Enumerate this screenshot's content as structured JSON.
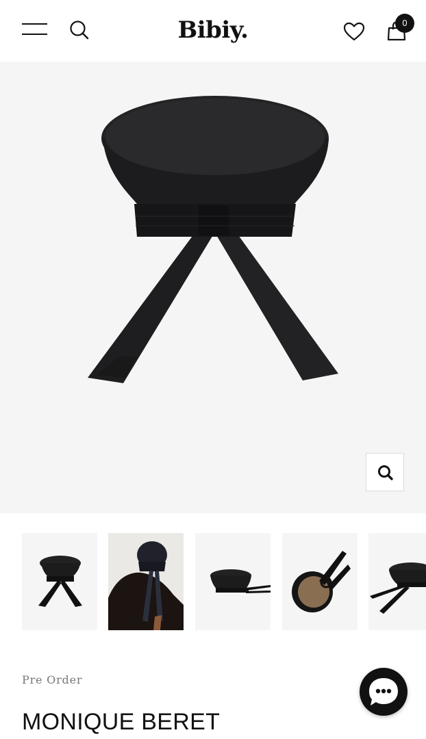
{
  "header": {
    "logo": "Bibiy.",
    "cart_count": "0",
    "icons": [
      "menu-icon",
      "search-icon",
      "heart-icon",
      "shopping-bag-icon"
    ]
  },
  "gallery": {
    "zoom_icon": "magnifier-icon",
    "thumbnails": [
      "beret-front",
      "beret-worn-back",
      "beret-side",
      "beret-inside",
      "beret-angle"
    ]
  },
  "product": {
    "status": "Pre Order",
    "name": "MONIQUE BERET"
  },
  "chat": {
    "icon": "chat-bubble-icon"
  },
  "colors": {
    "background": "#ffffff",
    "hero_bg": "#f5f5f5",
    "text": "#111111",
    "muted": "#777777"
  }
}
